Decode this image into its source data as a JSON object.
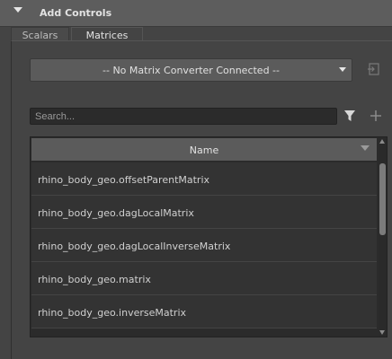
{
  "section": {
    "title": "Add Controls",
    "collapse_icon": "triangle-down-icon"
  },
  "tabs": [
    {
      "label": "Scalars",
      "active": false
    },
    {
      "label": "Matrices",
      "active": true
    }
  ],
  "converter": {
    "selected": "-- No Matrix Converter Connected --",
    "icon": "chevron-down-icon",
    "side_icon": "import-icon"
  },
  "search": {
    "placeholder": "Search...",
    "value": "",
    "filter_icon": "filter-icon",
    "add_icon": "plus-icon"
  },
  "table": {
    "column": "Name",
    "rows": [
      "rhino_body_geo.offsetParentMatrix",
      "rhino_body_geo.dagLocalMatrix",
      "rhino_body_geo.dagLocalInverseMatrix",
      "rhino_body_geo.matrix",
      "rhino_body_geo.inverseMatrix"
    ]
  },
  "colors": {
    "background": "#444444",
    "header": "#5d5d5d",
    "field": "#2b2b2b",
    "row": "#333333"
  }
}
